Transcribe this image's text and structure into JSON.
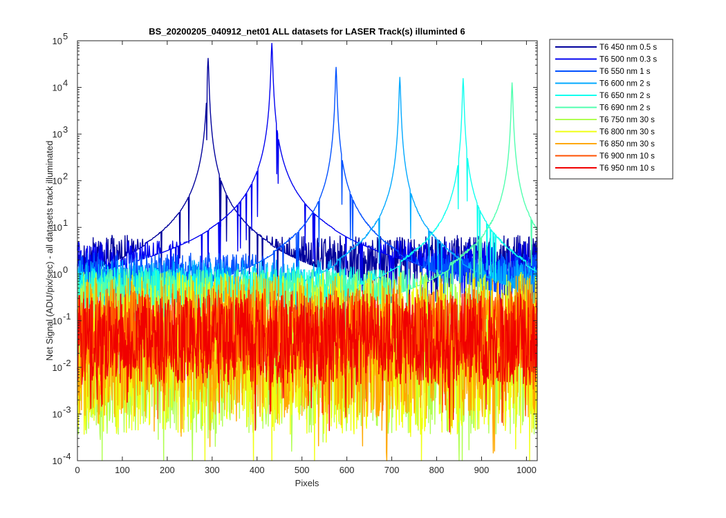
{
  "chart_data": {
    "type": "line",
    "title": "BS_20200205_040912_net01 ALL datasets for LASER  Track(s) illuminted 6",
    "xlabel": "Pixels",
    "ylabel": "Net Signal (ADU/pix/sec) - all datasets track illuminated",
    "xlim": [
      0,
      1024
    ],
    "ylim": [
      0.0001,
      100000
    ],
    "yscale": "log",
    "grid": false,
    "legend_position": "outside-top-right",
    "x_ticks": [
      "0",
      "100",
      "200",
      "300",
      "400",
      "500",
      "600",
      "700",
      "800",
      "900",
      "1000"
    ],
    "x_tick_values": [
      0,
      100,
      200,
      300,
      400,
      500,
      600,
      700,
      800,
      900,
      1000
    ],
    "y_ticks": [
      {
        "base": "10",
        "exp": "5",
        "value": 100000
      },
      {
        "base": "10",
        "exp": "4",
        "value": 10000
      },
      {
        "base": "10",
        "exp": "3",
        "value": 1000
      },
      {
        "base": "10",
        "exp": "2",
        "value": 100
      },
      {
        "base": "10",
        "exp": "1",
        "value": 10
      },
      {
        "base": "10",
        "exp": "0",
        "value": 1
      },
      {
        "base": "10",
        "exp": "-1",
        "value": 0.1
      },
      {
        "base": "10",
        "exp": "-2",
        "value": 0.01
      },
      {
        "base": "10",
        "exp": "-3",
        "value": 0.001
      },
      {
        "base": "10",
        "exp": "-4",
        "value": 0.0001
      }
    ],
    "series": [
      {
        "name": "T6 450 nm 0.5 s",
        "color": "#00009C",
        "peak_x": 291,
        "peak_y": 42000,
        "baseline": 2.0,
        "spread": 3.5
      },
      {
        "name": "T6 500 nm 0.3 s",
        "color": "#0000F0",
        "peak_x": 433,
        "peak_y": 88000,
        "baseline": 1.5,
        "spread": 3.5
      },
      {
        "name": "T6 550 nm 1 s",
        "color": "#0050FF",
        "peak_x": 576,
        "peak_y": 27000,
        "baseline": 1.0,
        "spread": 3.0
      },
      {
        "name": "T6 600 nm 2 s",
        "color": "#00A8FF",
        "peak_x": 718,
        "peak_y": 16500,
        "baseline": 0.7,
        "spread": 3.0
      },
      {
        "name": "T6 650 nm 2 s",
        "color": "#10FFEF",
        "peak_x": 859,
        "peak_y": 15500,
        "baseline": 0.5,
        "spread": 3.0
      },
      {
        "name": "T6 690 nm 2 s",
        "color": "#50FFAF",
        "peak_x": 968,
        "peak_y": 12500,
        "baseline": 0.45,
        "spread": 3.0
      },
      {
        "name": "T6 750 nm 30 s",
        "color": "#AFFF50",
        "peak_x": null,
        "peak_y": null,
        "baseline": 0.03,
        "spread": 8.0
      },
      {
        "name": "T6 800 nm 30 s",
        "color": "#F0FF10",
        "peak_x": null,
        "peak_y": null,
        "baseline": 0.03,
        "spread": 8.0
      },
      {
        "name": "T6 850 nm 30 s",
        "color": "#FFA800",
        "peak_x": null,
        "peak_y": null,
        "baseline": 0.04,
        "spread": 7.0
      },
      {
        "name": "T6 900 nm 10 s",
        "color": "#FF5000",
        "peak_x": null,
        "peak_y": null,
        "baseline": 0.08,
        "spread": 4.0
      },
      {
        "name": "T6 950 nm 10 s",
        "color": "#F00000",
        "peak_x": null,
        "peak_y": null,
        "baseline": 0.05,
        "spread": 4.5
      }
    ]
  }
}
